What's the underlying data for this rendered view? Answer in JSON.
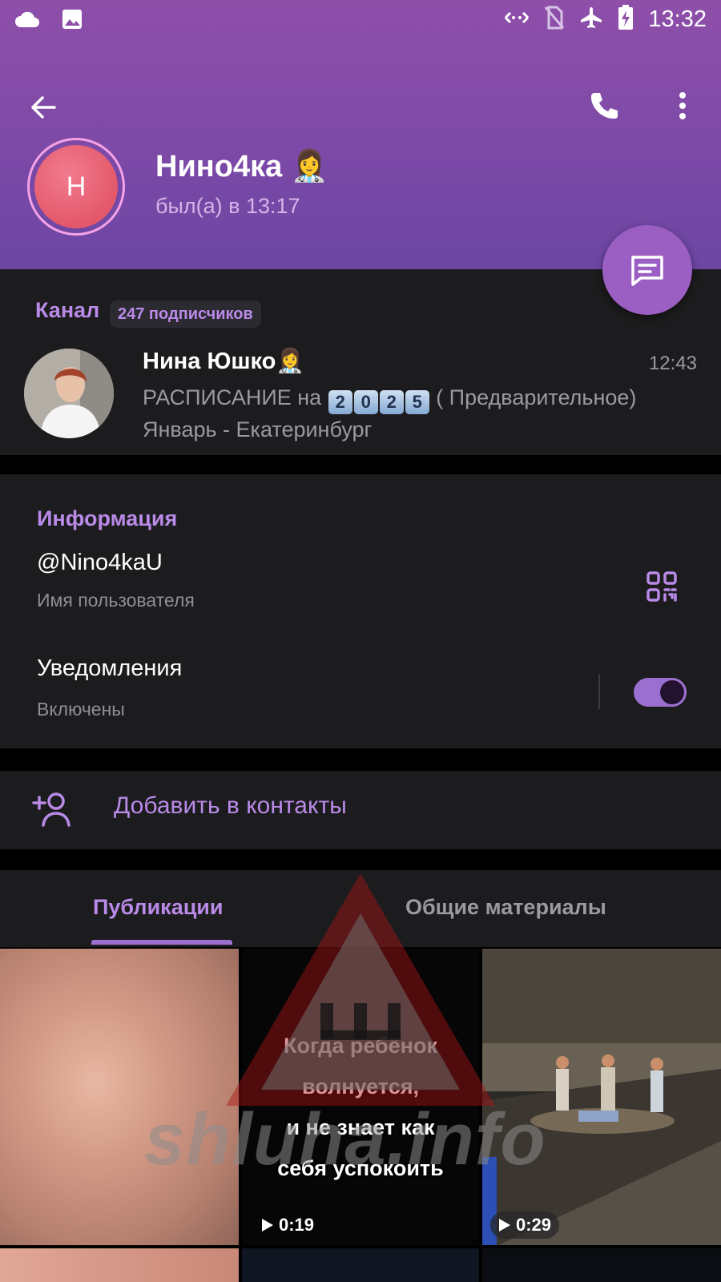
{
  "status_bar": {
    "time": "13:32",
    "left_icons": [
      "cloud-icon",
      "image-icon"
    ],
    "right_icons": [
      "data-saver-icon",
      "no-sim-icon",
      "airplane-icon",
      "battery-charging-icon"
    ]
  },
  "header": {
    "back_icon": "arrow-left-icon",
    "call_icon": "phone-icon",
    "more_icon": "more-vertical-icon",
    "avatar_letter": "Н",
    "name": "Нино4ка 👩‍⚕️",
    "status": "был(а) в 13:17",
    "message_icon": "message-icon"
  },
  "channel": {
    "title": "Канал",
    "subscribers": "247 подписчиков",
    "name": "Нина Юшко👩‍⚕️",
    "time": "12:43",
    "message_prefix": "РАСПИСАНИЕ  на ",
    "message_keycaps": [
      "2",
      "0",
      "2",
      "5"
    ],
    "message_suffix": " ( Предварительное)",
    "message_line2": "Январь - Екатеринбург"
  },
  "info": {
    "title": "Информация",
    "username": "@Nino4kaU",
    "username_label": "Имя пользователя",
    "notifications": "Уведомления",
    "notifications_state": "Включены",
    "notifications_enabled": true,
    "qr_icon": "qr-code-icon"
  },
  "add_contact": {
    "label": "Добавить в контакты",
    "icon": "add-user-icon"
  },
  "tabs": [
    {
      "label": "Публикации",
      "active": true
    },
    {
      "label": "Общие материалы",
      "active": false
    }
  ],
  "media": [
    {
      "type": "photo",
      "duration": ""
    },
    {
      "type": "video",
      "duration": "0:19",
      "caption": [
        "Когда ребёнок",
        "волнуется,",
        "и не знает как",
        "себя успокоить"
      ]
    },
    {
      "type": "video",
      "duration": "0:29"
    }
  ],
  "watermark": "shluha.info",
  "colors": {
    "header_gradient_top": "#8e4fa9",
    "header_gradient_bottom": "#6c46a3",
    "accent": "#b98ae8",
    "fab": "#9b5ec2",
    "section_bg": "#1c1c1e",
    "background": "#000000"
  }
}
